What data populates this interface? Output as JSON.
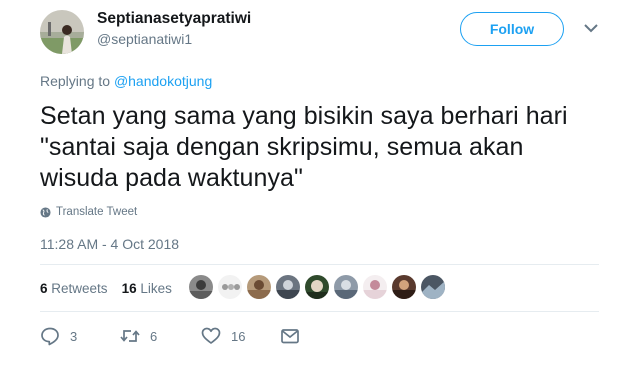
{
  "author": {
    "display_name": "Septianasetyapratiwi",
    "handle": "@septianatiwi1"
  },
  "follow_label": "Follow",
  "reply": {
    "prefix": "Replying to",
    "target": "@handokotjung"
  },
  "tweet": {
    "text": "Setan yang sama yang bisikin saya berhari hari \"santai saja dengan skripsimu, semua akan wisuda pada waktunya\""
  },
  "translate_label": "Translate Tweet",
  "timestamp": "11:28 AM - 4 Oct 2018",
  "stats": {
    "retweets_count": "6",
    "retweets_label": "Retweets",
    "likes_count": "16",
    "likes_label": "Likes"
  },
  "actions": {
    "reply_count": "3",
    "retweet_count": "6",
    "like_count": "16"
  },
  "icons": {
    "globe": "globe-icon",
    "caret": "chevron-down-icon",
    "reply": "reply-icon",
    "retweet": "retweet-icon",
    "like": "heart-icon",
    "dm": "envelope-icon"
  },
  "colors": {
    "accent": "#1da1f2",
    "secondary_text": "#657786",
    "divider": "#e6ecf0"
  }
}
